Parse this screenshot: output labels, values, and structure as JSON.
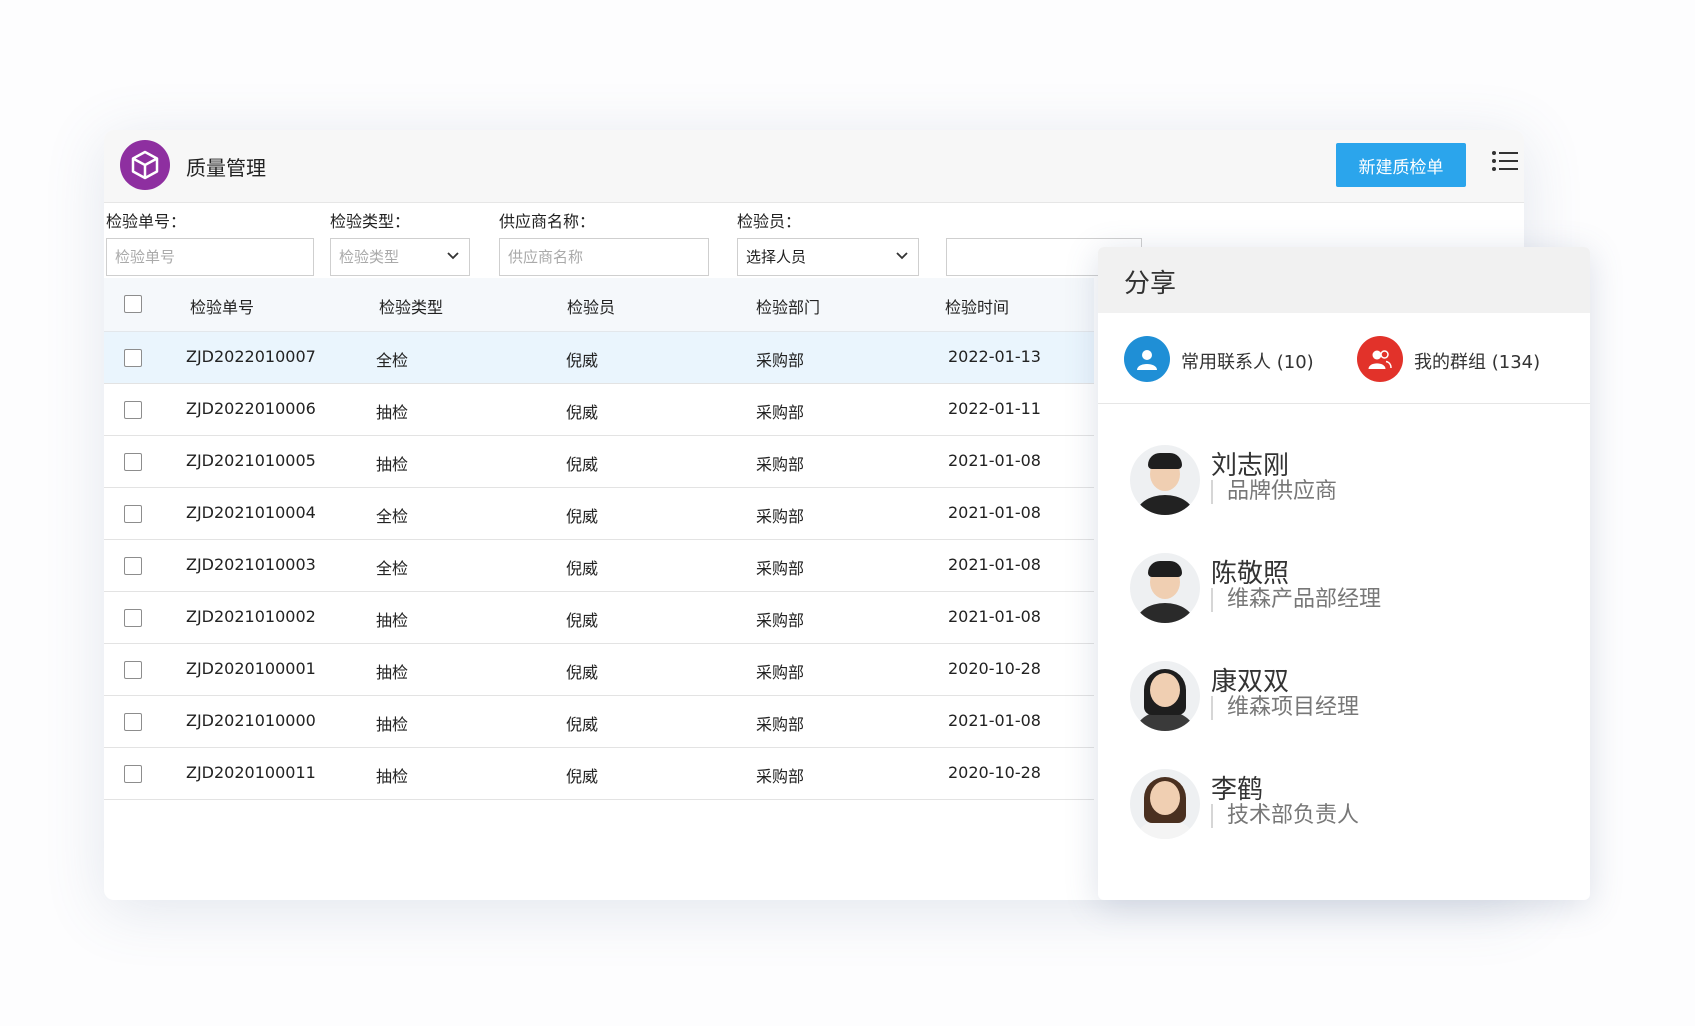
{
  "app": {
    "title": "质量管理",
    "new_button": "新建质检单"
  },
  "filters": {
    "order_no": {
      "label": "检验单号：",
      "placeholder": "检验单号"
    },
    "type": {
      "label": "检验类型：",
      "placeholder": "检验类型"
    },
    "supplier": {
      "label": "供应商名称：",
      "placeholder": "供应商名称"
    },
    "inspector": {
      "label": "检验员：",
      "value": "选择人员"
    }
  },
  "table": {
    "columns": [
      "检验单号",
      "检验类型",
      "检验员",
      "检验部门",
      "检验时间"
    ],
    "rows": [
      {
        "no": "ZJD2022010007",
        "type": "全检",
        "inspector": "倪威",
        "dept": "采购部",
        "date": "2022-01-13",
        "selected": true
      },
      {
        "no": "ZJD2022010006",
        "type": "抽检",
        "inspector": "倪威",
        "dept": "采购部",
        "date": "2022-01-11"
      },
      {
        "no": "ZJD2021010005",
        "type": "抽检",
        "inspector": "倪威",
        "dept": "采购部",
        "date": "2021-01-08"
      },
      {
        "no": "ZJD2021010004",
        "type": "全检",
        "inspector": "倪威",
        "dept": "采购部",
        "date": "2021-01-08"
      },
      {
        "no": "ZJD2021010003",
        "type": "全检",
        "inspector": "倪威",
        "dept": "采购部",
        "date": "2021-01-08"
      },
      {
        "no": "ZJD2021010002",
        "type": "抽检",
        "inspector": "倪威",
        "dept": "采购部",
        "date": "2021-01-08"
      },
      {
        "no": "ZJD2020100001",
        "type": "抽检",
        "inspector": "倪威",
        "dept": "采购部",
        "date": "2020-10-28"
      },
      {
        "no": "ZJD2021010000",
        "type": "抽检",
        "inspector": "倪威",
        "dept": "采购部",
        "date": "2021-01-08"
      },
      {
        "no": "ZJD2020100011",
        "type": "抽检",
        "inspector": "倪威",
        "dept": "采购部",
        "date": "2020-10-28"
      }
    ]
  },
  "share": {
    "title": "分享",
    "tabs": [
      {
        "label": "常用联系人 (10)",
        "icon": "user-icon",
        "color": "#1f8fd6"
      },
      {
        "label": "我的群组 (134)",
        "icon": "group-icon",
        "color": "#e2322a"
      }
    ],
    "contacts": [
      {
        "name": "刘志刚",
        "role": "品牌供应商"
      },
      {
        "name": "陈敬照",
        "role": "维森产品部经理"
      },
      {
        "name": "康双双",
        "role": "维森项目经理"
      },
      {
        "name": "李鹤",
        "role": "技术部负责人"
      }
    ]
  },
  "colors": {
    "primary": "#2ba5ec",
    "logo": "#8e2fa0",
    "selected_row": "#eaf5fd"
  }
}
